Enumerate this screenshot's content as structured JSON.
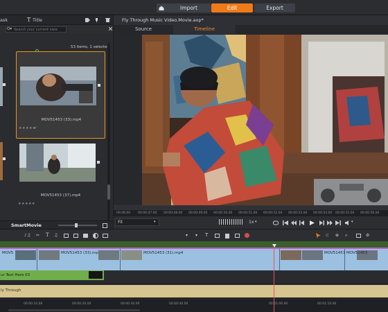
{
  "nav": {
    "import_label": "Import",
    "edit_label": "Edit",
    "export_label": "Export"
  },
  "library": {
    "tab_task": "ask",
    "tab_title": "Title",
    "search_placeholder": "Search your current view",
    "count_text": "53 items, 1 selected",
    "clips": [
      {
        "label": "MOV51453 (33).mp4",
        "stars": "★★★★★",
        "check": "✓"
      },
      {
        "label": "MOV51453 (37).mp4",
        "stars": "★★★★★"
      }
    ],
    "footer_label": "SmartMovie"
  },
  "player": {
    "title": "Fly Through Music Video.Movie.axp*",
    "tab_source": "Source",
    "tab_timeline": "Timeline",
    "ruler_ticks": [
      "00:46.00",
      "00:00:47.00",
      "00:00:48.00",
      "00:00:49.00",
      "00:00:50.00",
      "00:00:51.00",
      "00:00:52.00",
      "00:00:53.00",
      "00:00:54.00",
      "00:00:55.00",
      "00:00:56.00"
    ],
    "fit_label": "Fit",
    "speed_label": "1x"
  },
  "timeline": {
    "video_clips": [
      "MOV5",
      "MOV51453 (33).mp4",
      "MOV51453 (31).mp4",
      "MOV51453",
      "MOV51453"
    ],
    "title_clip": "ur Text Here 03",
    "audio_clip": "ly Through",
    "time_labels": [
      "00:00:10.00",
      "00:00:20.00",
      "00:00:30.00",
      "00:00:40.00",
      "00:01:00.00",
      "00:01:10.00"
    ]
  },
  "colors": {
    "accent": "#f07a18",
    "clip_blue": "#8db6dc",
    "title_green": "#6fae4a",
    "audio_tan": "#d6c58f",
    "playhead": "#e0565a"
  }
}
